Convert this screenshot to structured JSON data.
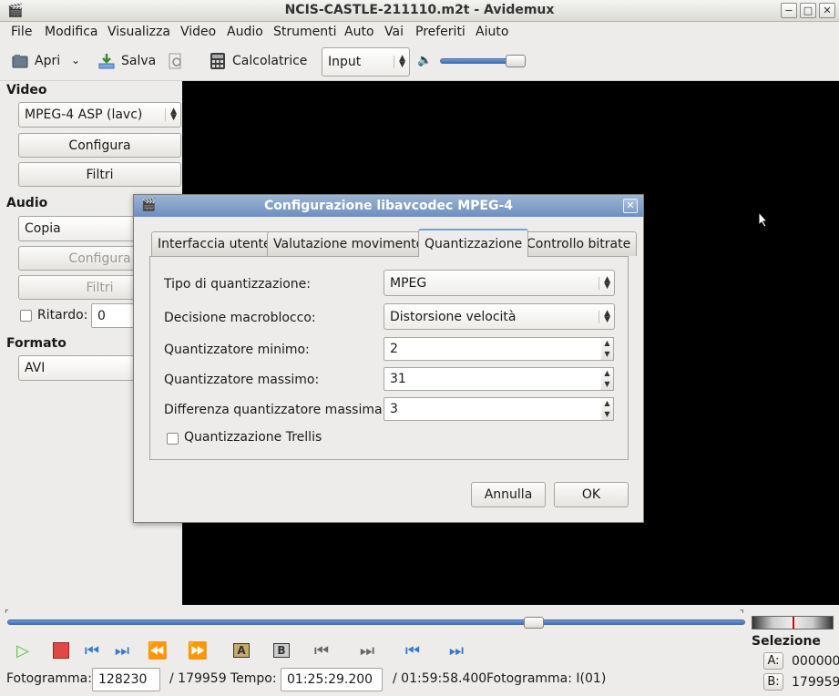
{
  "window": {
    "title": "NCIS-CASTLE-211110.m2t - Avidemux"
  },
  "menu": [
    "File",
    "Modifica",
    "Visualizza",
    "Video",
    "Audio",
    "Strumenti",
    "Auto",
    "Vai",
    "Preferiti",
    "Aiuto"
  ],
  "toolbar": {
    "open_label": "Apri",
    "save_label": "Salva",
    "calculator_label": "Calcolatrice",
    "input_select": "Input"
  },
  "video": {
    "section_title": "Video",
    "codec": "MPEG-4 ASP (lavc)",
    "configure_label": "Configura",
    "filters_label": "Filtri"
  },
  "audio": {
    "section_title": "Audio",
    "codec": "Copia",
    "configure_label": "Configura",
    "filters_label": "Filtri",
    "delay_label": "Ritardo:",
    "delay_value": "0"
  },
  "format": {
    "section_title": "Formato",
    "value": "AVI"
  },
  "dialog": {
    "title": "Configurazione libavcodec MPEG-4",
    "tabs": [
      "Interfaccia utente",
      "Valutazione movimento",
      "Quantizzazione",
      "Controllo bitrate"
    ],
    "active_tab": "Quantizzazione",
    "fields": {
      "quant_type_label": "Tipo di quantizzazione:",
      "quant_type_value": "MPEG",
      "macroblock_label": "Decisione macroblocco:",
      "macroblock_value": "Distorsione velocità",
      "min_quant_label": "Quantizzatore minimo:",
      "min_quant_value": "2",
      "max_quant_label": "Quantizzatore massimo:",
      "max_quant_value": "31",
      "max_diff_label": "Differenza quantizzatore massima:",
      "max_diff_value": "3",
      "trellis_label": "Quantizzazione Trellis"
    },
    "cancel_label": "Annulla",
    "ok_label": "OK"
  },
  "status": {
    "frame_label": "Fotogramma:",
    "frame_value": "128230",
    "frame_total": "/ 179959",
    "time_label": "Tempo:",
    "time_value": "01:25:29.200",
    "time_total": "/ 01:59:58.400",
    "frame_type": "Fotogramma: I(01)"
  },
  "selection": {
    "title": "Selezione",
    "a_label": "A:",
    "a_value": "000000",
    "b_label": "B:",
    "b_value": "179959"
  },
  "timeline_position": 0.713,
  "colors": {
    "accent": "#3d70b8",
    "dialog_title": "#7f9cc6",
    "video_bg": "#000000"
  }
}
